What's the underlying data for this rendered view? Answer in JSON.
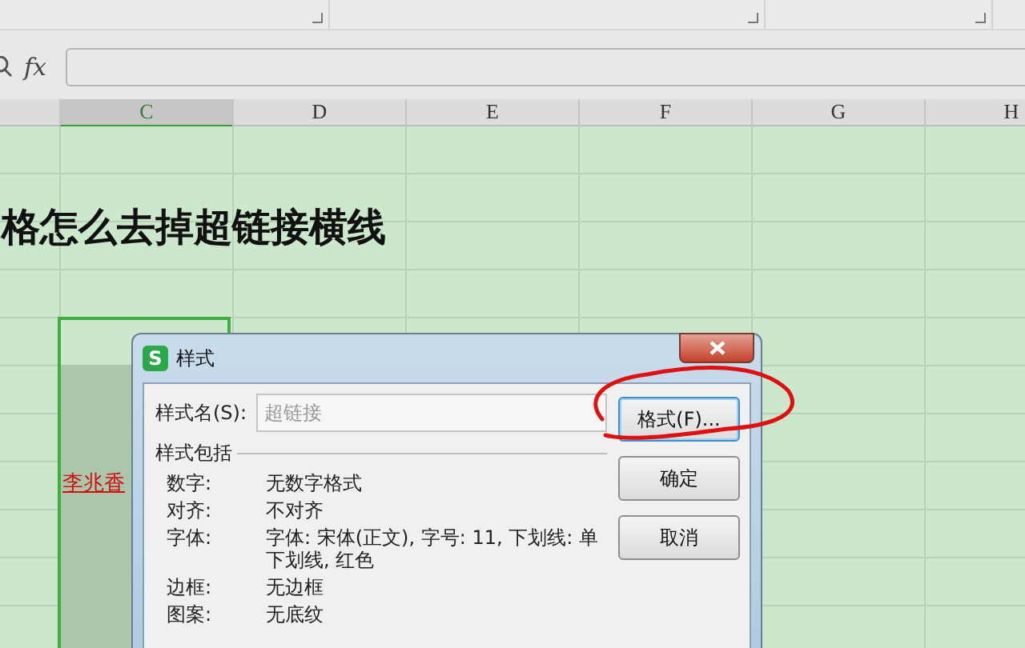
{
  "formula_bar": {
    "fx_label": "fx"
  },
  "columns": [
    {
      "label": "C",
      "selected": true
    },
    {
      "label": "D",
      "selected": false
    },
    {
      "label": "E",
      "selected": false
    },
    {
      "label": "F",
      "selected": false
    },
    {
      "label": "G",
      "selected": false
    },
    {
      "label": "H",
      "selected": false
    }
  ],
  "sheet": {
    "heading": "格怎么去掉超链接横线",
    "link_cell": "李兆香"
  },
  "dialog": {
    "app_icon_letter": "S",
    "title": "样式",
    "style_name": {
      "label": "样式名(S):",
      "placeholder": "超链接"
    },
    "includes_label": "样式包括",
    "properties": [
      {
        "label": "数字:",
        "value": "无数字格式"
      },
      {
        "label": "对齐:",
        "value": "不对齐"
      },
      {
        "label": "字体:",
        "value": "字体: 宋体(正文), 字号: 11, 下划线: 单下划线, 红色"
      },
      {
        "label": "边框:",
        "value": "无边框"
      },
      {
        "label": "图案:",
        "value": "无底纹"
      }
    ],
    "buttons": [
      {
        "label": "格式(F)...",
        "focused": true
      },
      {
        "label": "确定",
        "focused": false
      },
      {
        "label": "取消",
        "focused": false
      }
    ]
  }
}
